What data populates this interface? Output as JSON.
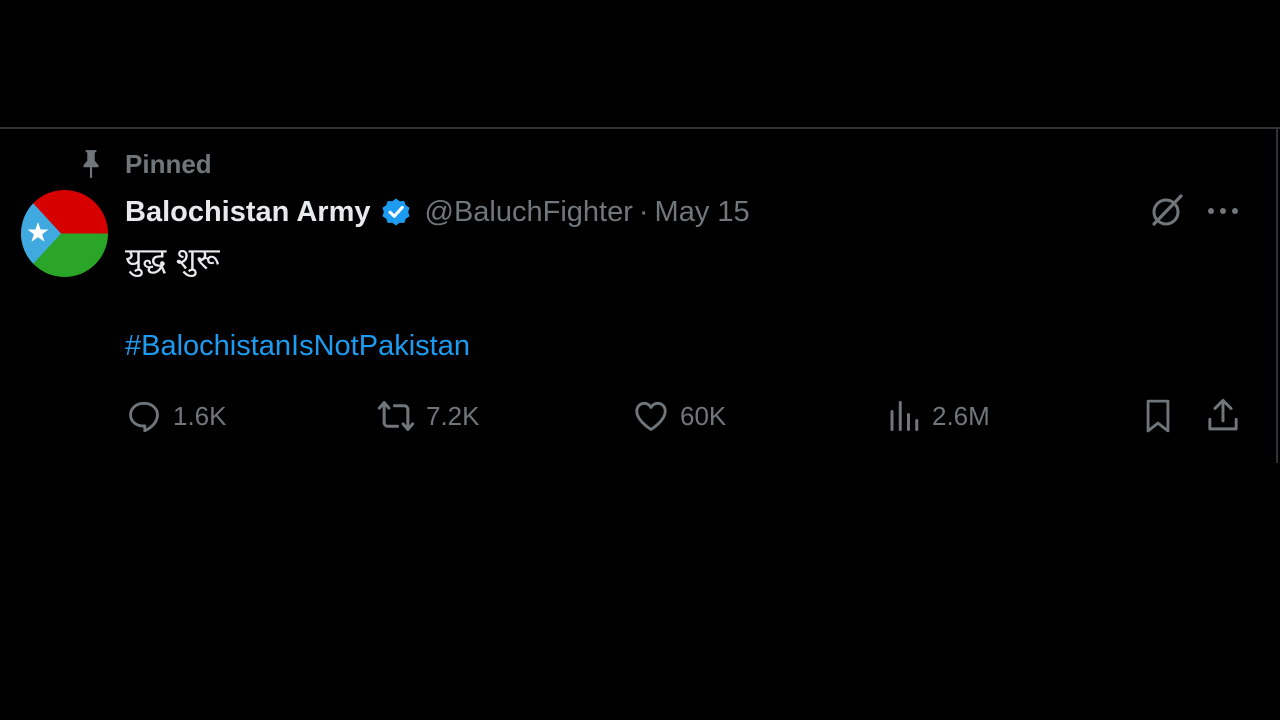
{
  "tweet": {
    "pinned_label": "Pinned",
    "author": {
      "display_name": "Balochistan Army",
      "handle": "@BaluchFighter",
      "verified": true
    },
    "separator": "·",
    "date": "May 15",
    "text": "युद्ध शुरू",
    "hashtag": "#BalochistanIsNotPakistan",
    "actions": {
      "replies": "1.6K",
      "reposts": "7.2K",
      "likes": "60K",
      "views": "2.6M"
    },
    "icons": [
      "pin-icon",
      "grok-icon",
      "more-icon",
      "reply-icon",
      "repost-icon",
      "like-icon",
      "views-icon",
      "bookmark-icon",
      "share-icon",
      "verified-badge-icon"
    ]
  },
  "colors": {
    "background": "#000000",
    "text": "#e7e9ea",
    "secondary": "#71767b",
    "link": "#1d9bf0",
    "verified": "#1d9bf0",
    "flag_red": "#d60000",
    "flag_green": "#2aa527",
    "flag_blue": "#3fa9e0"
  }
}
